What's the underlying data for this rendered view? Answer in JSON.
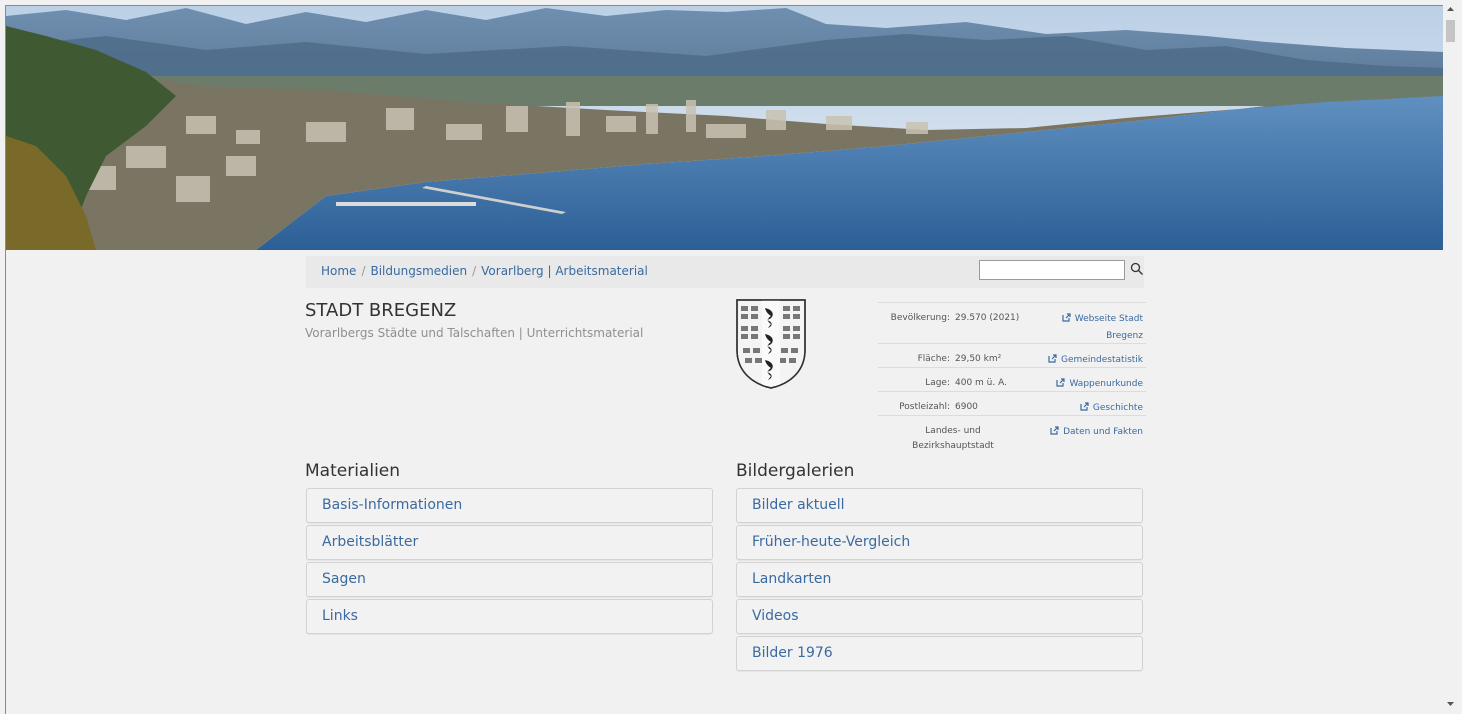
{
  "breadcrumb": {
    "items": [
      "Home",
      "Bildungsmedien",
      "Vorarlberg | Arbeitsmaterial"
    ]
  },
  "search": {
    "placeholder": ""
  },
  "header": {
    "title": "STADT BREGENZ",
    "subtitle": "Vorarlbergs Städte und Talschaften | Unterrichtsmaterial"
  },
  "facts": [
    {
      "label": "Bevölkerung:",
      "value": "29.570 (2021)",
      "link": "Webseite Stadt Bregenz"
    },
    {
      "label": "Fläche:",
      "value": "29,50 km²",
      "link": "Gemeindestatistik"
    },
    {
      "label": "Lage:",
      "value": "400 m ü. A.",
      "link": "Wappenurkunde"
    },
    {
      "label": "Postleizahl:",
      "value": "6900",
      "link": "Geschichte"
    },
    {
      "label": "Landes- und Bezirkshauptstadt",
      "value": "",
      "link": "Daten und Fakten"
    }
  ],
  "materialien": {
    "heading": "Materialien",
    "items": [
      "Basis-Informationen",
      "Arbeitsblätter",
      "Sagen",
      "Links"
    ]
  },
  "bildergalerien": {
    "heading": "Bildergalerien",
    "items": [
      "Bilder aktuell",
      "Früher-heute-Vergleich",
      "Landkarten",
      "Videos",
      "Bilder 1976"
    ]
  },
  "icons": {
    "search": "search-icon",
    "external_link": "external-link-icon",
    "crest": "bregenz-coat-of-arms"
  },
  "colors": {
    "link": "#3a6aa0",
    "background": "#f1f1f1",
    "lake": "#3f78b0"
  }
}
